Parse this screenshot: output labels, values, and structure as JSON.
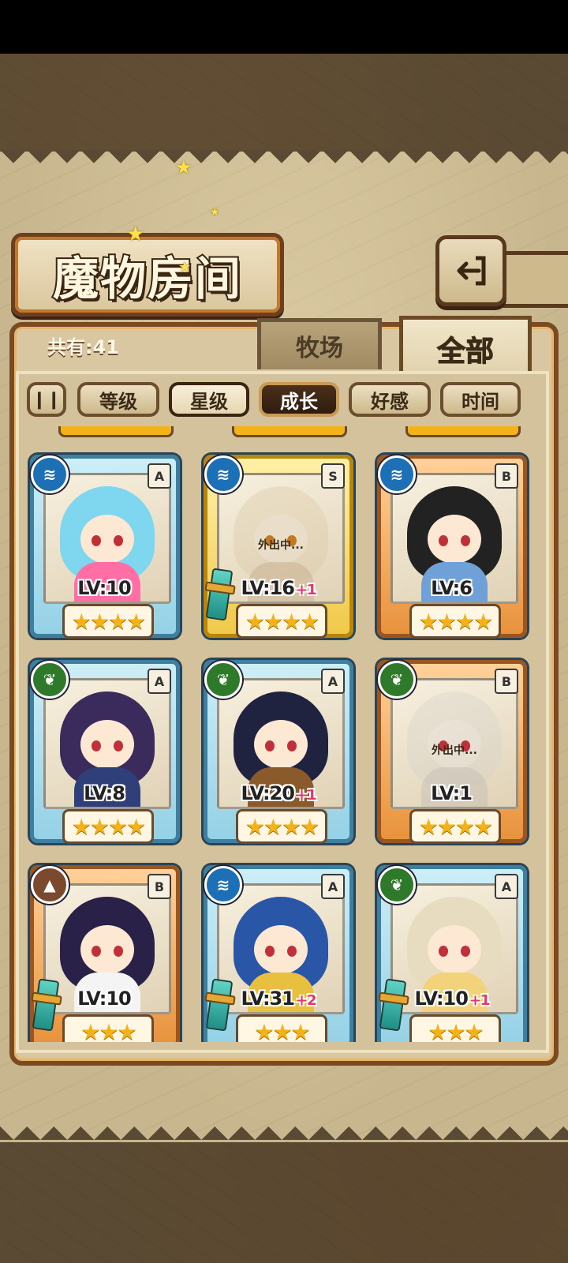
{
  "header": {
    "title": "魔物房间"
  },
  "count_label": "共有:41",
  "tabs": [
    {
      "label": "牧场",
      "active": false
    },
    {
      "label": "全部",
      "active": true
    }
  ],
  "sort_buttons": [
    {
      "label": "等级",
      "state": "normal"
    },
    {
      "label": "星级",
      "state": "active"
    },
    {
      "label": "成长",
      "state": "dark"
    },
    {
      "label": "好感",
      "state": "normal"
    },
    {
      "label": "时间",
      "state": "normal"
    }
  ],
  "sort_toggle_icon": "pause-icon",
  "monsters": [
    {
      "element": "water",
      "rank": "A",
      "level": "LV:10",
      "bonus": "",
      "stars": "★★★★",
      "frame": "blue",
      "away": "",
      "equipped": false,
      "hair": "#7fd6ef",
      "outfit": "#ff6fa6"
    },
    {
      "element": "water",
      "rank": "S",
      "level": "LV:16",
      "bonus": "+1",
      "stars": "★★★★",
      "frame": "gold",
      "away": "外出中...",
      "equipped": true,
      "hair": "#f2c56b",
      "outfit": "#e49b4a"
    },
    {
      "element": "water",
      "rank": "B",
      "level": "LV:6",
      "bonus": "",
      "stars": "★★★★",
      "frame": "orange",
      "away": "",
      "equipped": false,
      "hair": "#222222",
      "outfit": "#6fa0d8"
    },
    {
      "element": "leaf",
      "rank": "A",
      "level": "LV:8",
      "bonus": "",
      "stars": "★★★★",
      "frame": "blue",
      "away": "",
      "equipped": false,
      "hair": "#3b2b5c",
      "outfit": "#2f3f7a"
    },
    {
      "element": "leaf",
      "rank": "A",
      "level": "LV:20",
      "bonus": "+1",
      "stars": "★★★★",
      "frame": "blue",
      "away": "",
      "equipped": false,
      "hair": "#1f2340",
      "outfit": "#8a5a2a"
    },
    {
      "element": "leaf",
      "rank": "B",
      "level": "LV:1",
      "bonus": "",
      "stars": "★★★★",
      "frame": "orange",
      "away": "外出中...",
      "equipped": false,
      "hair": "#d9d2c4",
      "outfit": "#bfb6a6"
    },
    {
      "element": "earth",
      "rank": "B",
      "level": "LV:10",
      "bonus": "",
      "stars": "★★★",
      "frame": "orange",
      "away": "",
      "equipped": true,
      "hair": "#2a2148",
      "outfit": "#f4f4f4"
    },
    {
      "element": "water",
      "rank": "A",
      "level": "LV:31",
      "bonus": "+2",
      "stars": "★★★",
      "frame": "blue",
      "away": "",
      "equipped": true,
      "hair": "#2a56a8",
      "outfit": "#e8c040"
    },
    {
      "element": "leaf",
      "rank": "A",
      "level": "LV:10",
      "bonus": "+1",
      "stars": "★★★",
      "frame": "blue",
      "away": "",
      "equipped": true,
      "hair": "#e8dcc0",
      "outfit": "#f2d27a"
    }
  ],
  "element_icons": {
    "water": "water-wave-icon",
    "leaf": "leaf-icon",
    "earth": "mountain-icon"
  },
  "colors": {
    "accent": "#6b3f1f",
    "star": "#f3b21a",
    "bonus": "#e0386c"
  }
}
